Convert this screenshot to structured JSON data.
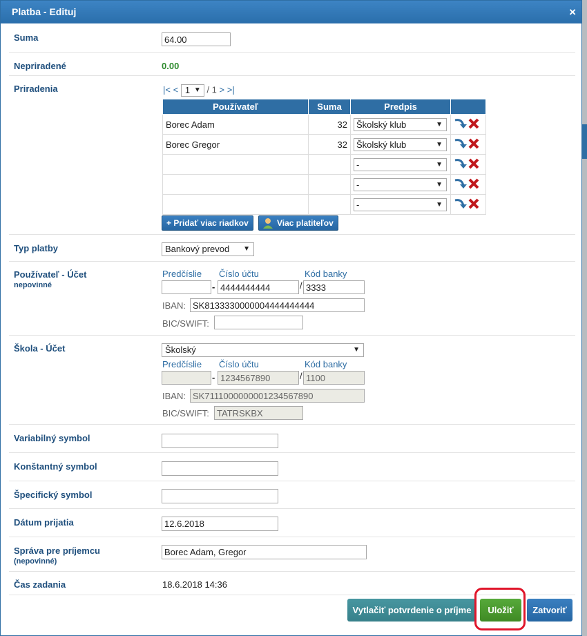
{
  "dialog": {
    "title": "Platba - Edituj",
    "close_glyph": "×"
  },
  "suma": {
    "label": "Suma",
    "value": "64.00"
  },
  "nepriradene": {
    "label": "Nepriradené",
    "value": "0.00"
  },
  "priradenia": {
    "label": "Priradenia",
    "pager": {
      "first": "|<",
      "prev": "<",
      "page": "1",
      "of": "/ 1",
      "next": ">",
      "last": ">|"
    },
    "columns": [
      "Používateľ",
      "Suma",
      "Predpis"
    ],
    "rows": [
      {
        "user": "Borec Adam",
        "suma": "32",
        "predpis": "Školský klub"
      },
      {
        "user": "Borec Gregor",
        "suma": "32",
        "predpis": "Školský klub"
      },
      {
        "user": "",
        "suma": "",
        "predpis": "-"
      },
      {
        "user": "",
        "suma": "",
        "predpis": "-"
      },
      {
        "user": "",
        "suma": "",
        "predpis": "-"
      }
    ],
    "add_rows_label": "+ Pridať viac riadkov",
    "more_payers_label": "Viac platiteľov"
  },
  "typ_platby": {
    "label": "Typ platby",
    "value": "Bankový prevod"
  },
  "user_account": {
    "label": "Používateľ - Účet",
    "sublabel": "nepovinné",
    "predcislie_label": "Predčíslie",
    "cislo_label": "Číslo účtu",
    "kod_label": "Kód banky",
    "dash": "-",
    "slash": "/",
    "predcislie": "",
    "cislo": "4444444444",
    "kod": "3333",
    "iban_label": "IBAN:",
    "iban": "SK8133330000004444444444",
    "bic_label": "BIC/SWIFT:",
    "bic": ""
  },
  "school_account": {
    "label": "Škola - Účet",
    "select": "Školský",
    "predcislie_label": "Predčíslie",
    "cislo_label": "Číslo účtu",
    "kod_label": "Kód banky",
    "dash": "-",
    "slash": "/",
    "predcislie": "",
    "cislo": "1234567890",
    "kod": "1100",
    "iban_label": "IBAN:",
    "iban": "SK7111000000001234567890",
    "bic_label": "BIC/SWIFT:",
    "bic": "TATRSKBX"
  },
  "variabilny": {
    "label": "Variabilný symbol",
    "value": ""
  },
  "konstantny": {
    "label": "Konštantný symbol",
    "value": ""
  },
  "specificky": {
    "label": "Špecifický symbol",
    "value": ""
  },
  "datum": {
    "label": "Dátum prijatia",
    "value": "12.6.2018"
  },
  "sprava": {
    "label": "Správa pre príjemcu",
    "sublabel": "(nepovinné)",
    "value": "Borec Adam, Gregor"
  },
  "cas": {
    "label": "Čas zadania",
    "value": "18.6.2018 14:36"
  },
  "footer": {
    "print_label": "Vytlačiť potvrdenie o príjme",
    "save_label": "Uložiť",
    "close_label": "Zatvoriť"
  },
  "colors": {
    "primary": "#2f6ea4",
    "save_green": "#4a9a2e",
    "teal": "#3f8a94",
    "highlight_red": "#e0152a",
    "zero_green": "#2e8b2e"
  }
}
